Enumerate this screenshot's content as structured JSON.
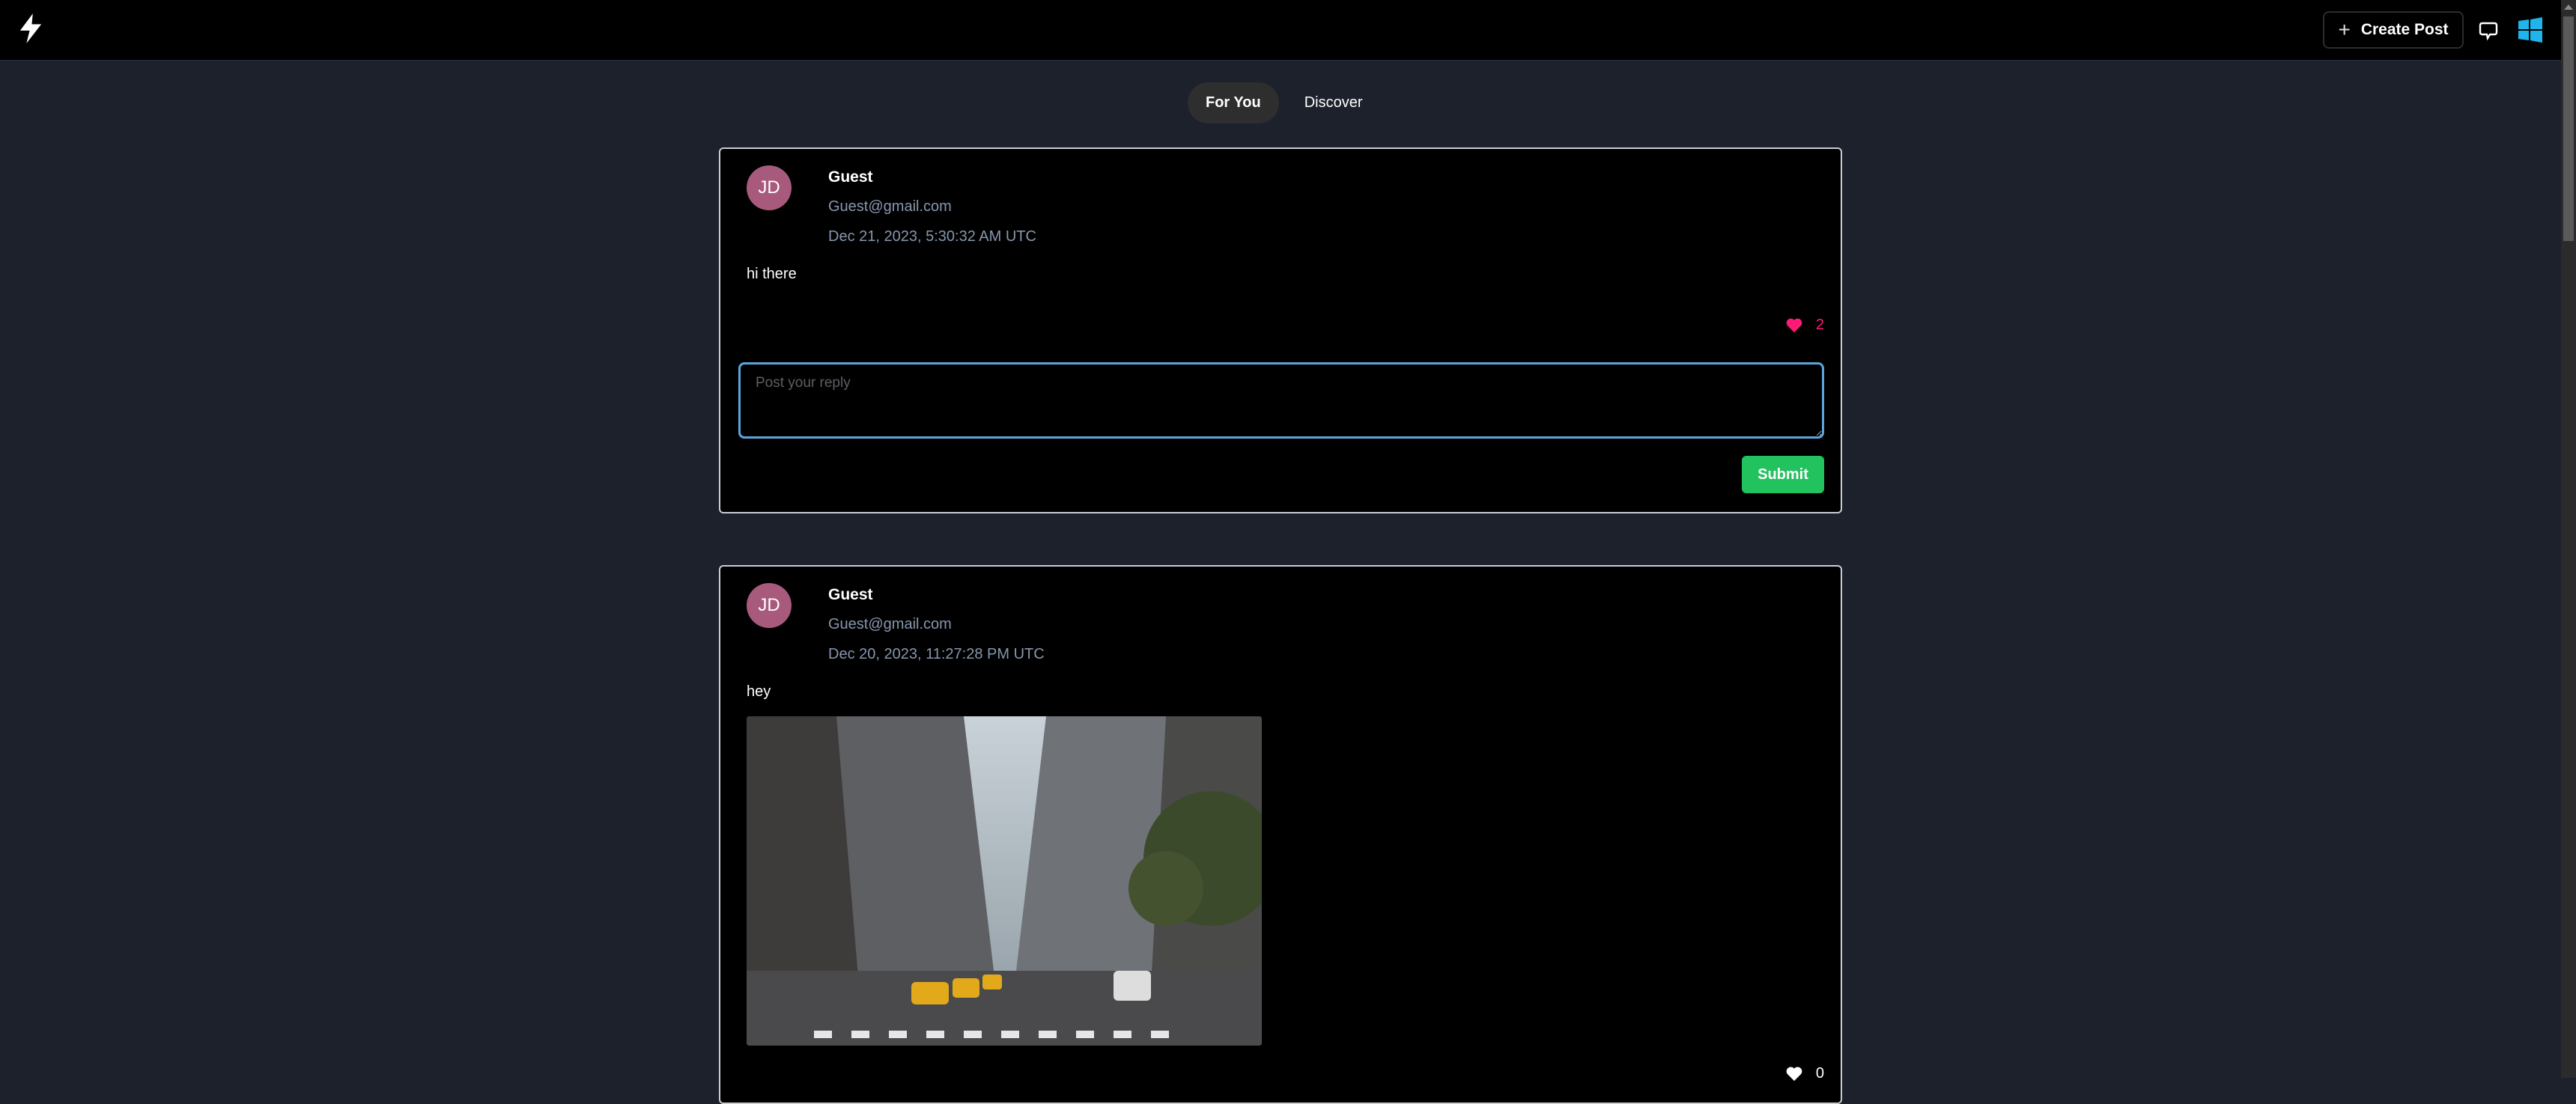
{
  "header": {
    "logo_icon": "lightning-bolt-icon",
    "create_post_label": "Create Post",
    "create_post_icon": "plus-icon",
    "chat_icon": "chat-bubble-icon",
    "windows_icon": "windows-logo-icon",
    "accent": "#1fb4ea"
  },
  "tabs": [
    {
      "label": "For You",
      "active": true
    },
    {
      "label": "Discover",
      "active": false
    }
  ],
  "posts": [
    {
      "avatar_initials": "JD",
      "author": "Guest",
      "email": "Guest@gmail.com",
      "date": "Dec 21, 2023, 5:30:32 AM UTC",
      "content": "hi there",
      "likes": "2",
      "liked": true,
      "reply_placeholder": "Post your reply",
      "reply_value": "",
      "submit_label": "Submit"
    },
    {
      "avatar_initials": "JD",
      "author": "Guest",
      "email": "Guest@gmail.com",
      "date": "Dec 20, 2023, 11:27:28 PM UTC",
      "content": "hey",
      "image": "city street photo with yellow taxis and skyscrapers",
      "likes": "0",
      "liked": false
    }
  ],
  "colors": {
    "like_active": "#ff1a75",
    "submit": "#22c25e",
    "avatar": "#a85a7c",
    "meta_text": "#8697ad"
  }
}
